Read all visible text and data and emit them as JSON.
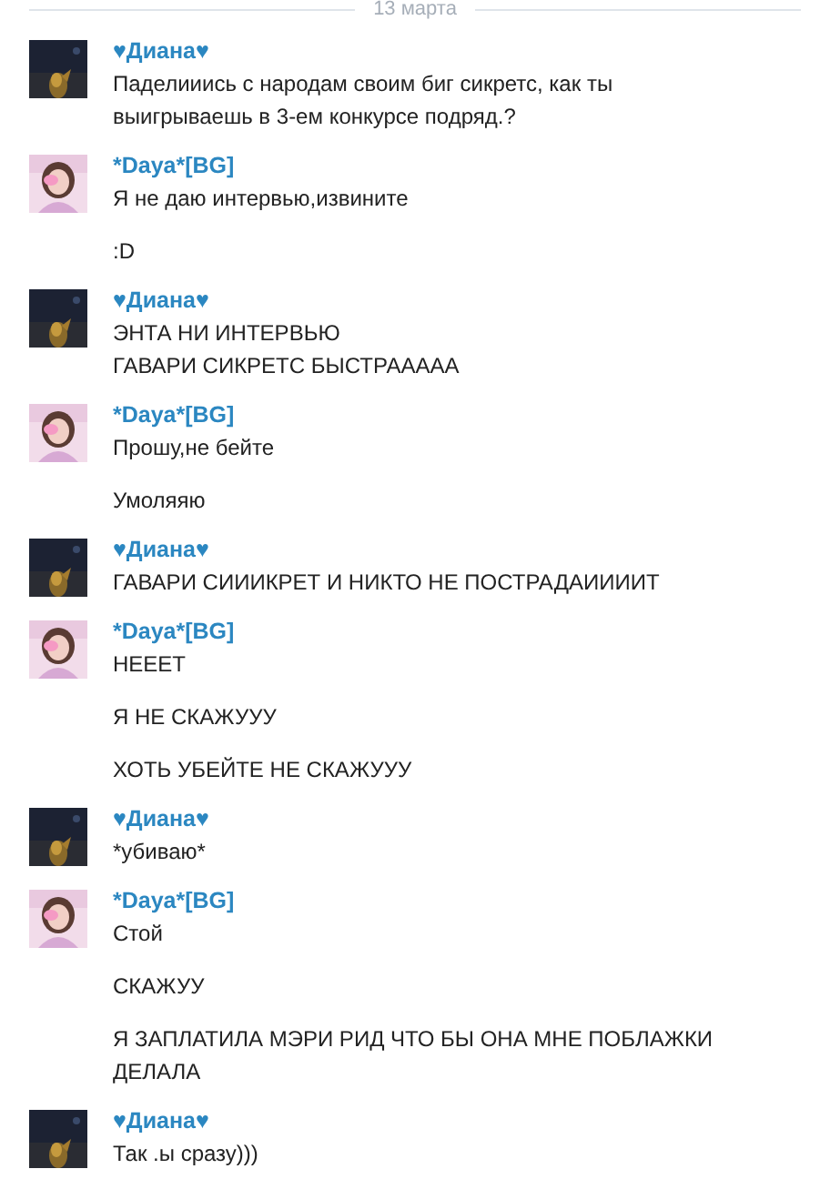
{
  "date_divider": "13 марта",
  "messages": [
    {
      "author": "♥Диана♥",
      "avatar": {
        "kind": "night"
      },
      "texts": [
        "Паделииись с народам своим биг сикретс, как ты выигрываешь в 3-ем конкурсе подряд.?"
      ]
    },
    {
      "author": "*Daya*[BG]",
      "avatar": {
        "kind": "pink"
      },
      "texts": [
        "Я не даю интервью,извините",
        ":D"
      ]
    },
    {
      "author": "♥Диана♥",
      "avatar": {
        "kind": "night"
      },
      "texts": [
        "ЭНТА НИ ИНТЕРВЬЮ\nГАВАРИ СИКРЕТС БЫСТРААААА"
      ]
    },
    {
      "author": "*Daya*[BG]",
      "avatar": {
        "kind": "pink"
      },
      "texts": [
        "Прошу,не бейте",
        "Умоляяю"
      ]
    },
    {
      "author": "♥Диана♥",
      "avatar": {
        "kind": "night"
      },
      "texts": [
        "ГАВАРИ СИИИКРЕТ И НИКТО НЕ ПОСТРАДАИИИИТ"
      ]
    },
    {
      "author": "*Daya*[BG]",
      "avatar": {
        "kind": "pink"
      },
      "texts": [
        "НЕЕЕТ",
        "Я НЕ СКАЖУУУ",
        "ХОТЬ УБЕЙТЕ НЕ СКАЖУУУ"
      ]
    },
    {
      "author": "♥Диана♥",
      "avatar": {
        "kind": "night"
      },
      "texts": [
        "*убиваю*"
      ]
    },
    {
      "author": "*Daya*[BG]",
      "avatar": {
        "kind": "pink"
      },
      "texts": [
        "Стой",
        "СКАЖУУ",
        "Я ЗАПЛАТИЛА МЭРИ РИД ЧТО БЫ ОНА МНЕ ПОБЛАЖКИ ДЕЛАЛА"
      ]
    },
    {
      "author": "♥Диана♥",
      "avatar": {
        "kind": "night"
      },
      "texts": [
        "Так .ы сразу)))"
      ]
    }
  ]
}
